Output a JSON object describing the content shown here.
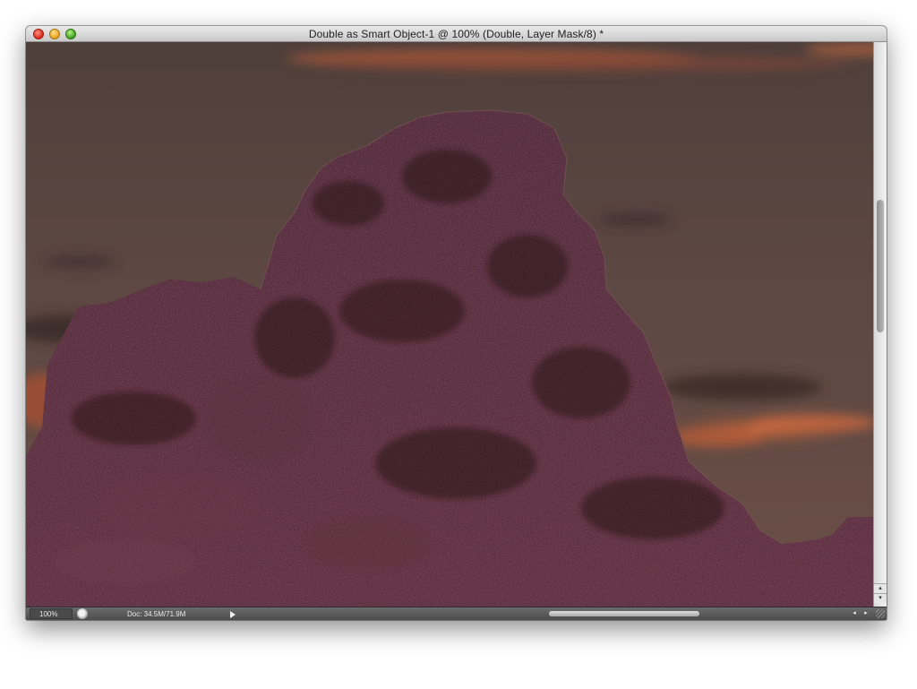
{
  "window": {
    "title": "Double as Smart Object-1 @ 100% (Double, Layer Mask/8) *"
  },
  "traffic_lights": {
    "close": "close-button",
    "minimize": "minimize-button",
    "zoom": "zoom-button"
  },
  "status_bar": {
    "zoom": "100%",
    "doc_info": "Doc: 34.5M/71.9M",
    "left_arrow": "◂",
    "right_arrow": "▸"
  },
  "scrollbars": {
    "up_arrow": "▴",
    "down_arrow": "▾"
  },
  "colors": {
    "sky": "#5f4a44",
    "rock": "#3a1d1e",
    "cloud_glow": "#c8683e"
  }
}
